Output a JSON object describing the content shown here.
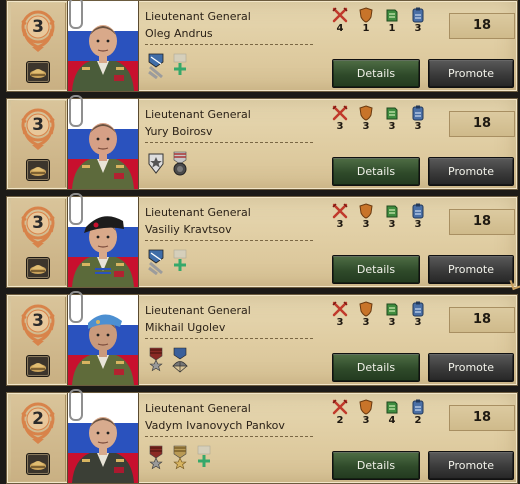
{
  "colors": {
    "panel": "#dfcca1",
    "details_button": "#2f4a2a",
    "promote_button": "#3a3a3a",
    "stat_attack": "#c0392b",
    "stat_defense": "#c8742a",
    "stat_planning": "#3f8c3f",
    "stat_logistics": "#4a6fa5",
    "skill_badge": "#d8834a"
  },
  "generals": [
    {
      "rank": "Lieutenant General",
      "name": "Oleg Andrus",
      "skill": "3",
      "stats": {
        "attack": "4",
        "defense": "1",
        "planning": "1",
        "logistics": "3"
      },
      "xp": "18",
      "traits": [
        "striped-shield-trait-icon",
        "add-trait-slot-icon"
      ],
      "details_label": "Details",
      "promote_label": "Promote"
    },
    {
      "rank": "Lieutenant General",
      "name": "Yury Boirosv",
      "skill": "3",
      "stats": {
        "attack": "3",
        "defense": "3",
        "planning": "3",
        "logistics": "3"
      },
      "xp": "18",
      "traits": [
        "star-shield-trait-icon",
        "medal-trait-icon"
      ],
      "details_label": "Details",
      "promote_label": "Promote"
    },
    {
      "rank": "Lieutenant General",
      "name": "Vasiliy Kravtsov",
      "skill": "3",
      "stats": {
        "attack": "3",
        "defense": "3",
        "planning": "3",
        "logistics": "3"
      },
      "xp": "18",
      "traits": [
        "striped-shield-trait-icon",
        "add-trait-slot-icon"
      ],
      "details_label": "Details",
      "promote_label": "Promote"
    },
    {
      "rank": "Lieutenant General",
      "name": "Mikhail Ugolev",
      "skill": "3",
      "stats": {
        "attack": "3",
        "defense": "3",
        "planning": "3",
        "logistics": "3"
      },
      "xp": "18",
      "traits": [
        "red-medal-trait-icon",
        "parachute-trait-icon"
      ],
      "details_label": "Details",
      "promote_label": "Promote"
    },
    {
      "rank": "Lieutenant General",
      "name": "Vadym Ivanovych Pankov",
      "skill": "2",
      "stats": {
        "attack": "2",
        "defense": "3",
        "planning": "4",
        "logistics": "2"
      },
      "xp": "18",
      "traits": [
        "red-medal-trait-icon",
        "gold-medal-trait-icon",
        "add-trait-slot-icon"
      ],
      "details_label": "Details",
      "promote_label": "Promote"
    }
  ]
}
